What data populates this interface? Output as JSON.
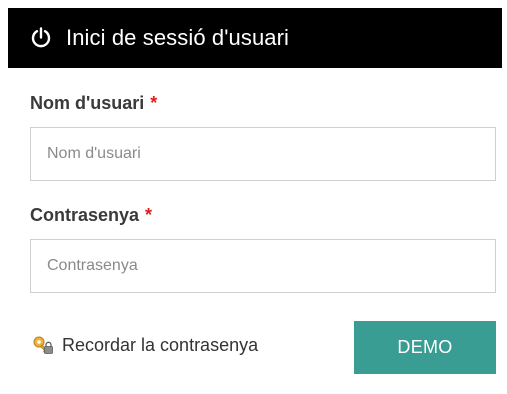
{
  "header": {
    "icon": "power-icon",
    "title": "Inici de sessió d'usuari"
  },
  "form": {
    "username": {
      "label": "Nom d'usuari",
      "required_mark": "*",
      "placeholder": "Nom d'usuari",
      "value": ""
    },
    "password": {
      "label": "Contrasenya",
      "required_mark": "*",
      "placeholder": "Contrasenya",
      "value": ""
    },
    "remember": {
      "icon": "key-lock-icon",
      "label": "Recordar la contrasenya"
    },
    "submit_label": "DEMO"
  },
  "colors": {
    "header_bg": "#000000",
    "required": "#e31b1b",
    "button_bg": "#3a9d94"
  }
}
